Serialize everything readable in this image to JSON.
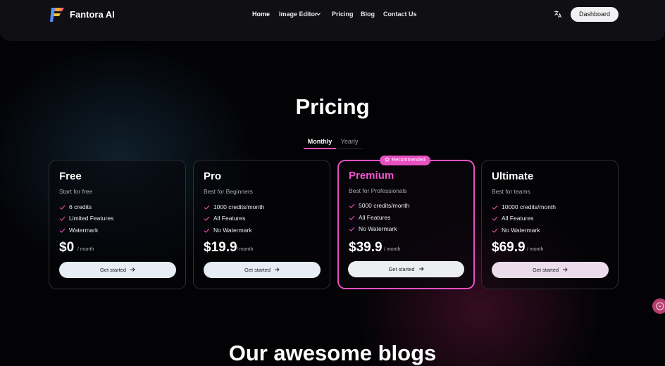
{
  "header": {
    "brand": "Fantora AI",
    "nav": {
      "home": "Home",
      "image_editor": "Image Editor",
      "pricing": "Pricing",
      "blog": "Blog",
      "contact": "Contact Us"
    },
    "dashboard_label": "Dashboard",
    "icons": {
      "logo": "fantora-logo",
      "language": "translate-icon",
      "dropdown": "chevron-down-icon"
    }
  },
  "pricing": {
    "title": "Pricing",
    "tabs": {
      "monthly": "Monthly",
      "yearly": "Yearly",
      "selected": "Monthly"
    },
    "accent_color": "#e84fc2",
    "plans": [
      {
        "name": "Free",
        "subtitle": "Start for free",
        "features": [
          "6 credits",
          "Limited Features",
          "Watermark"
        ],
        "price": "$0",
        "period": "/ month",
        "cta": "Get started"
      },
      {
        "name": "Pro",
        "subtitle": "Best for Beginners",
        "features": [
          "1000 credits/month",
          "All Features",
          "No Watermark"
        ],
        "price": "$19.9",
        "period": "/ month",
        "cta": "Get started"
      },
      {
        "name": "Premium",
        "badge": "Recommended",
        "subtitle": "Best for Professionals",
        "features": [
          "5000 credits/month",
          "All Features",
          "No Watermark"
        ],
        "price": "$39.9",
        "period": "/ month",
        "cta": "Get started"
      },
      {
        "name": "Ultimate",
        "subtitle": "Best for teams",
        "features": [
          "10000 credits/month",
          "All Features",
          "No Watermark"
        ],
        "price": "$69.9",
        "period": "/ month",
        "cta": "Get started"
      }
    ]
  },
  "blogs": {
    "title": "Our awesome blogs"
  }
}
